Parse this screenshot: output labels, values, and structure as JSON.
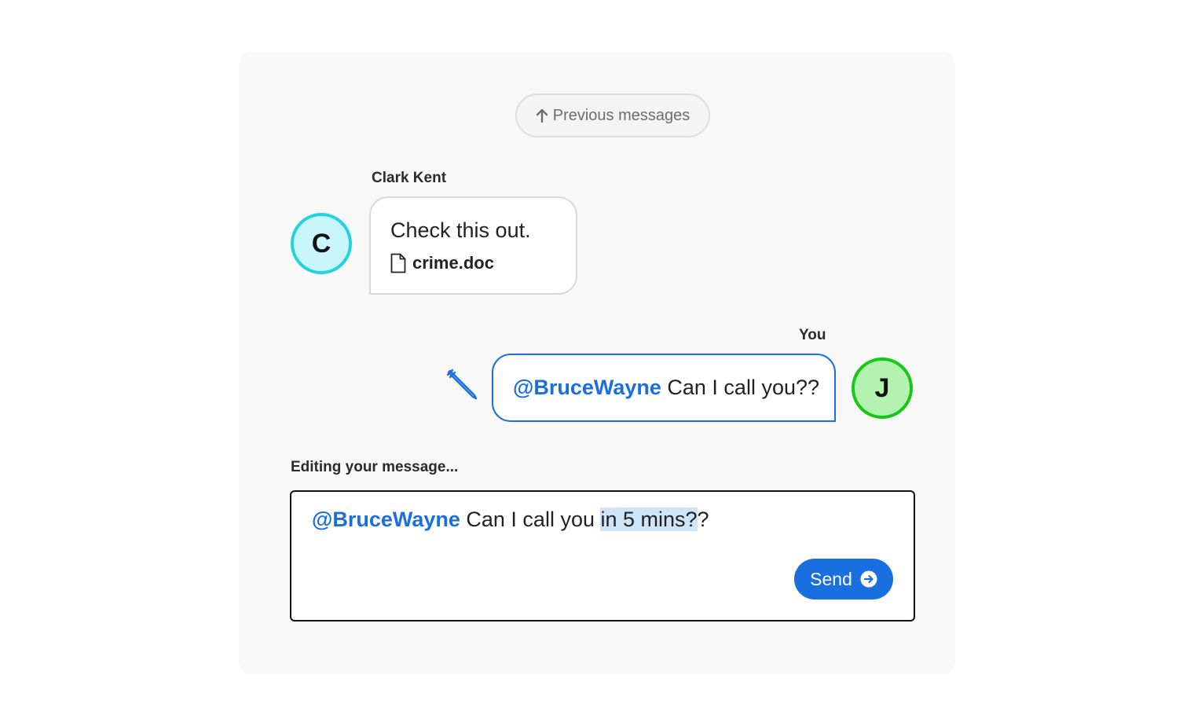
{
  "history": {
    "previous_label": "Previous messages",
    "previous_icon": "arrow-up-icon"
  },
  "messages": [
    {
      "sender": "Clark Kent",
      "avatar_letter": "C",
      "avatar_color": "#c9f6fa",
      "avatar_border": "#22d2de",
      "text": "Check this out.",
      "attachment": {
        "icon": "document-icon",
        "name": "crime.doc"
      }
    },
    {
      "sender": "You",
      "avatar_letter": "J",
      "avatar_color": "#b4f2b1",
      "avatar_border": "#14c814",
      "mention": "@BruceWayne",
      "text": " Can I call you??",
      "edit_icon": "pencil-icon"
    }
  ],
  "editor": {
    "label": "Editing your message...",
    "mention": "@BruceWayne",
    "text_before": " Can I call you ",
    "text_selected": "in 5 mins?",
    "text_after": "?",
    "send_label": "Send",
    "send_icon": "arrow-right-circle-icon"
  },
  "colors": {
    "accent": "#1a6fe0",
    "selection": "#cfe4f7"
  }
}
